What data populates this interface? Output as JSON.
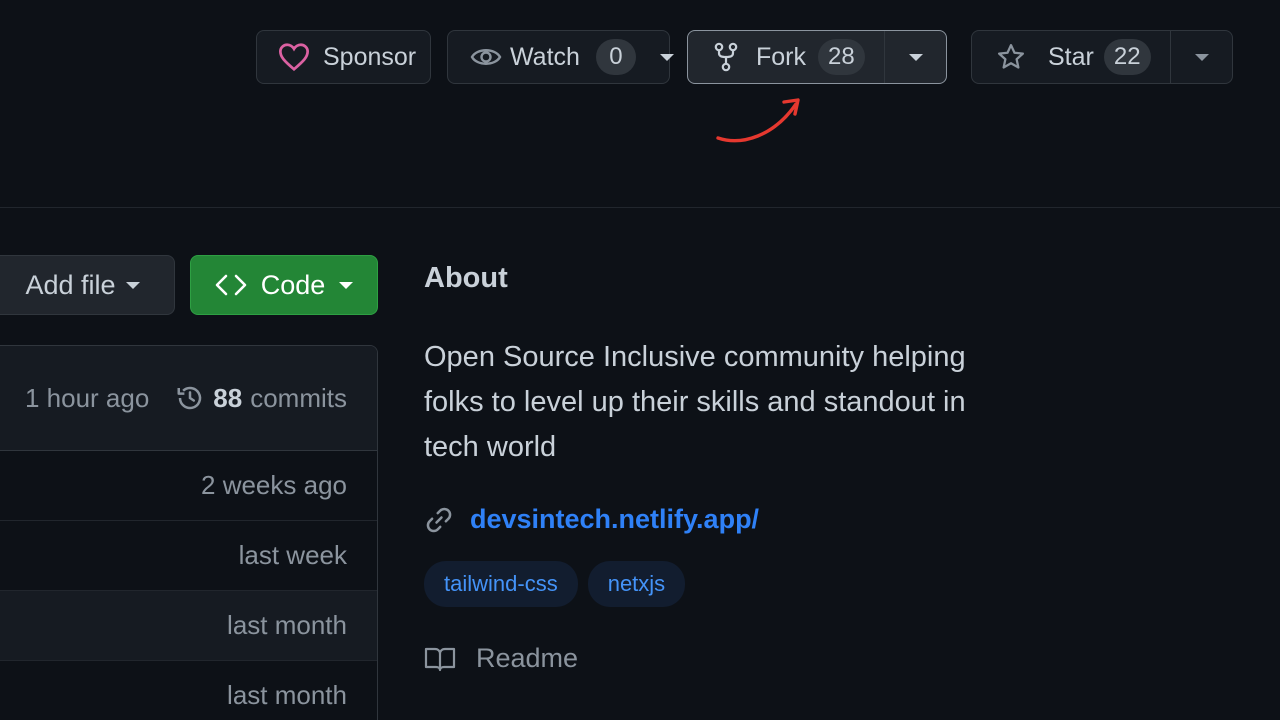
{
  "header": {
    "sponsor_label": "Sponsor",
    "watch_label": "Watch",
    "watch_count": "0",
    "fork_label": "Fork",
    "fork_count": "28",
    "star_label": "Star",
    "star_count": "22"
  },
  "toolbar": {
    "add_file_label": "Add file",
    "code_label": "Code"
  },
  "commits": {
    "last_updated": "1 hour ago",
    "count": "88",
    "count_label": "commits"
  },
  "files": [
    {
      "updated": "2 weeks ago"
    },
    {
      "updated": "last week"
    },
    {
      "updated": "last month"
    },
    {
      "updated": "last month"
    }
  ],
  "about": {
    "title": "About",
    "description": "Open Source Inclusive community helping folks to level up their skills and standout in tech world",
    "website": "devsintech.netlify.app/",
    "topics": [
      "tailwind-css",
      "netxjs"
    ],
    "readme_label": "Readme"
  },
  "colors": {
    "background": "#0d1117",
    "button_bg": "#161b22",
    "border": "#30363d",
    "code_button": "#238636",
    "link": "#2f81f7",
    "sponsor_heart": "#db61a2",
    "annotation_arrow": "#e5382f"
  },
  "icons": [
    "heart-icon",
    "eye-icon",
    "fork-icon",
    "star-icon",
    "code-icon",
    "history-icon",
    "link-icon",
    "book-icon",
    "annotation-arrow"
  ]
}
